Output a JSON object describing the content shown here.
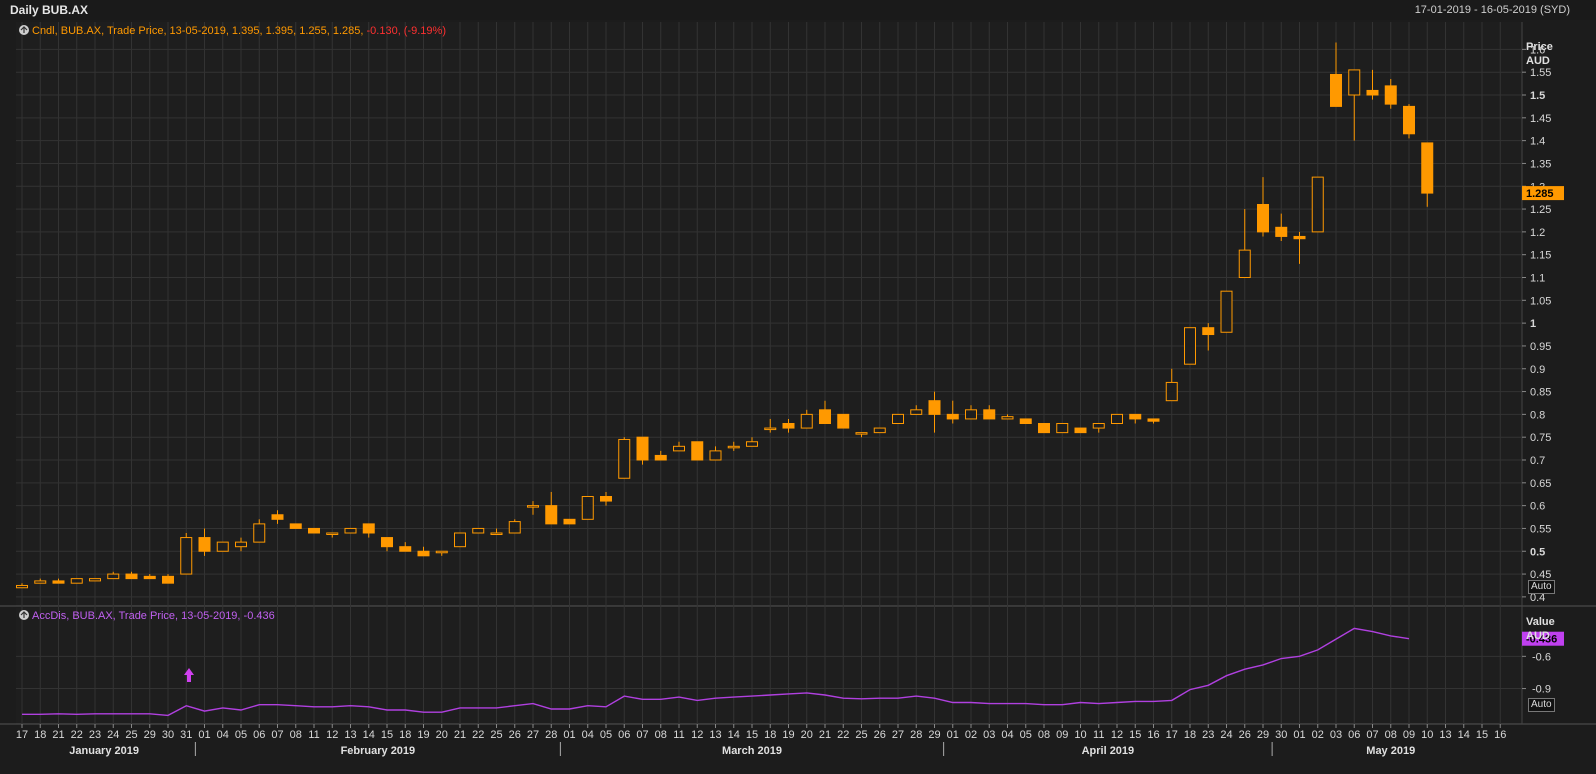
{
  "header": {
    "title": "Daily BUB.AX",
    "date_range": "17-01-2019 - 16-05-2019 (SYD)"
  },
  "legend_price": "Cndl, BUB.AX, Trade Price, 13-05-2019, 1.395, 1.395, 1.255, 1.285, -0.130, (-9.19%)",
  "legend_price_parts": {
    "prefix": "Cndl, BUB.AX, Trade Price, 13-05-2019, 1.395, 1.395, 1.255, 1.285, ",
    "change": "-0.130, (-9.19%)"
  },
  "legend_accdis": "AccDis, BUB.AX, Trade Price, 13-05-2019, -0.436",
  "auto_label": "Auto",
  "colors": {
    "candle": "#ff9900",
    "accdis": "#b040e0",
    "change": "#ff3030",
    "grid": "#333333",
    "background": "#1c1c1c"
  },
  "chart_data": [
    {
      "type": "candlestick",
      "title": "Daily BUB.AX",
      "ylabel": "Price AUD",
      "ylim": [
        0.38,
        1.66
      ],
      "yticks": [
        "0.4",
        "0.45",
        "0.5",
        "0.55",
        "0.6",
        "0.65",
        "0.7",
        "0.75",
        "0.8",
        "0.85",
        "0.9",
        "0.95",
        "1",
        "1.05",
        "1.1",
        "1.15",
        "1.2",
        "1.25",
        "1.3",
        "1.35",
        "1.4",
        "1.45",
        "1.5",
        "1.55",
        "1.6"
      ],
      "last_value_label": "1.285",
      "x_labels": [
        "17",
        "18",
        "21",
        "22",
        "23",
        "24",
        "25",
        "29",
        "30",
        "31",
        "01",
        "04",
        "05",
        "06",
        "07",
        "08",
        "11",
        "12",
        "13",
        "14",
        "15",
        "18",
        "19",
        "20",
        "21",
        "22",
        "25",
        "26",
        "27",
        "28",
        "01",
        "04",
        "05",
        "06",
        "07",
        "08",
        "11",
        "12",
        "13",
        "14",
        "15",
        "18",
        "19",
        "20",
        "21",
        "22",
        "25",
        "26",
        "27",
        "28",
        "29",
        "01",
        "02",
        "03",
        "04",
        "05",
        "08",
        "09",
        "10",
        "11",
        "12",
        "15",
        "16",
        "17",
        "18",
        "23",
        "24",
        "26",
        "29",
        "30",
        "01",
        "02",
        "03",
        "06",
        "07",
        "08",
        "09",
        "10",
        "13",
        "14",
        "15",
        "16"
      ],
      "months": [
        {
          "label": "January 2019",
          "start": "17 Jan",
          "end": "31 Jan"
        },
        {
          "label": "February 2019",
          "start": "01 Feb",
          "end": "28 Feb"
        },
        {
          "label": "March 2019",
          "start": "01 Mar",
          "end": "29 Mar"
        },
        {
          "label": "April 2019",
          "start": "01 Apr",
          "end": "30 Apr"
        },
        {
          "label": "May 2019",
          "start": "01 May",
          "end": "16 May"
        }
      ],
      "ohlc": [
        [
          0.42,
          0.43,
          0.42,
          0.425
        ],
        [
          0.43,
          0.44,
          0.43,
          0.435
        ],
        [
          0.435,
          0.44,
          0.43,
          0.43
        ],
        [
          0.43,
          0.44,
          0.43,
          0.44
        ],
        [
          0.435,
          0.44,
          0.435,
          0.44
        ],
        [
          0.44,
          0.455,
          0.44,
          0.45
        ],
        [
          0.45,
          0.455,
          0.44,
          0.44
        ],
        [
          0.445,
          0.45,
          0.44,
          0.44
        ],
        [
          0.445,
          0.45,
          0.43,
          0.43
        ],
        [
          0.45,
          0.54,
          0.45,
          0.53
        ],
        [
          0.53,
          0.55,
          0.49,
          0.5
        ],
        [
          0.5,
          0.52,
          0.5,
          0.52
        ],
        [
          0.51,
          0.53,
          0.5,
          0.52
        ],
        [
          0.52,
          0.57,
          0.52,
          0.56
        ],
        [
          0.58,
          0.59,
          0.56,
          0.57
        ],
        [
          0.56,
          0.56,
          0.55,
          0.55
        ],
        [
          0.55,
          0.55,
          0.54,
          0.54
        ],
        [
          0.54,
          0.54,
          0.53,
          0.54
        ],
        [
          0.54,
          0.55,
          0.54,
          0.55
        ],
        [
          0.56,
          0.56,
          0.53,
          0.54
        ],
        [
          0.53,
          0.53,
          0.5,
          0.51
        ],
        [
          0.51,
          0.52,
          0.5,
          0.5
        ],
        [
          0.5,
          0.51,
          0.49,
          0.49
        ],
        [
          0.5,
          0.5,
          0.49,
          0.5
        ],
        [
          0.51,
          0.54,
          0.51,
          0.54
        ],
        [
          0.54,
          0.55,
          0.54,
          0.55
        ],
        [
          0.54,
          0.55,
          0.54,
          0.54
        ],
        [
          0.54,
          0.57,
          0.54,
          0.565
        ],
        [
          0.6,
          0.61,
          0.58,
          0.6
        ],
        [
          0.6,
          0.63,
          0.56,
          0.56
        ],
        [
          0.57,
          0.57,
          0.56,
          0.56
        ],
        [
          0.57,
          0.62,
          0.57,
          0.62
        ],
        [
          0.62,
          0.63,
          0.6,
          0.61
        ],
        [
          0.66,
          0.75,
          0.66,
          0.745
        ],
        [
          0.75,
          0.75,
          0.69,
          0.7
        ],
        [
          0.71,
          0.72,
          0.7,
          0.7
        ],
        [
          0.72,
          0.74,
          0.72,
          0.73
        ],
        [
          0.74,
          0.74,
          0.7,
          0.7
        ],
        [
          0.7,
          0.73,
          0.7,
          0.72
        ],
        [
          0.73,
          0.74,
          0.72,
          0.73
        ],
        [
          0.73,
          0.75,
          0.73,
          0.74
        ],
        [
          0.77,
          0.79,
          0.76,
          0.77
        ],
        [
          0.78,
          0.79,
          0.76,
          0.77
        ],
        [
          0.77,
          0.81,
          0.77,
          0.8
        ],
        [
          0.81,
          0.83,
          0.78,
          0.78
        ],
        [
          0.8,
          0.8,
          0.77,
          0.77
        ],
        [
          0.76,
          0.76,
          0.75,
          0.76
        ],
        [
          0.76,
          0.77,
          0.76,
          0.77
        ],
        [
          0.78,
          0.8,
          0.78,
          0.8
        ],
        [
          0.8,
          0.82,
          0.8,
          0.81
        ],
        [
          0.83,
          0.85,
          0.76,
          0.8
        ],
        [
          0.8,
          0.83,
          0.78,
          0.79
        ],
        [
          0.79,
          0.82,
          0.79,
          0.81
        ],
        [
          0.81,
          0.82,
          0.79,
          0.79
        ],
        [
          0.79,
          0.8,
          0.79,
          0.795
        ],
        [
          0.79,
          0.79,
          0.78,
          0.78
        ],
        [
          0.78,
          0.78,
          0.76,
          0.76
        ],
        [
          0.76,
          0.78,
          0.76,
          0.78
        ],
        [
          0.77,
          0.77,
          0.76,
          0.76
        ],
        [
          0.77,
          0.78,
          0.76,
          0.78
        ],
        [
          0.78,
          0.8,
          0.78,
          0.8
        ],
        [
          0.8,
          0.8,
          0.78,
          0.79
        ],
        [
          0.79,
          0.79,
          0.78,
          0.785
        ],
        [
          0.83,
          0.9,
          0.83,
          0.87
        ],
        [
          0.91,
          0.99,
          0.91,
          0.99
        ],
        [
          0.99,
          1.0,
          0.94,
          0.975
        ],
        [
          0.98,
          1.07,
          0.98,
          1.07
        ],
        [
          1.1,
          1.25,
          1.1,
          1.16
        ],
        [
          1.26,
          1.32,
          1.19,
          1.2
        ],
        [
          1.21,
          1.24,
          1.18,
          1.19
        ],
        [
          1.19,
          1.2,
          1.13,
          1.185
        ],
        [
          1.2,
          1.32,
          1.2,
          1.32
        ],
        [
          1.545,
          1.615,
          1.48,
          1.475
        ],
        [
          1.5,
          1.555,
          1.4,
          1.555
        ],
        [
          1.51,
          1.555,
          1.49,
          1.5
        ],
        [
          1.52,
          1.535,
          1.47,
          1.48
        ],
        [
          1.475,
          1.48,
          1.405,
          1.415
        ],
        [
          1.395,
          1.395,
          1.255,
          1.285
        ]
      ]
    },
    {
      "type": "line",
      "title": "AccDis",
      "ylabel": "Value AUD",
      "ylim": [
        -1.23,
        -0.15
      ],
      "yticks": [
        "-0.6",
        "-0.9"
      ],
      "last_value_label": "-0.436",
      "series": [
        {
          "name": "AccDis",
          "values": [
            -1.14,
            -1.14,
            -1.135,
            -1.14,
            -1.135,
            -1.135,
            -1.135,
            -1.135,
            -1.15,
            -1.06,
            -1.11,
            -1.08,
            -1.1,
            -1.05,
            -1.05,
            -1.06,
            -1.07,
            -1.07,
            -1.06,
            -1.07,
            -1.1,
            -1.1,
            -1.12,
            -1.12,
            -1.08,
            -1.08,
            -1.08,
            -1.06,
            -1.04,
            -1.09,
            -1.09,
            -1.06,
            -1.07,
            -0.97,
            -1.0,
            -1.0,
            -0.98,
            -1.01,
            -0.99,
            -0.98,
            -0.97,
            -0.96,
            -0.95,
            -0.94,
            -0.96,
            -0.99,
            -0.995,
            -0.99,
            -0.99,
            -0.97,
            -0.99,
            -1.03,
            -1.03,
            -1.04,
            -1.04,
            -1.04,
            -1.05,
            -1.05,
            -1.03,
            -1.04,
            -1.03,
            -1.02,
            -1.02,
            -1.01,
            -0.91,
            -0.87,
            -0.78,
            -0.72,
            -0.68,
            -0.62,
            -0.6,
            -0.54,
            -0.44,
            -0.34,
            -0.37,
            -0.41,
            -0.436
          ]
        }
      ]
    }
  ]
}
